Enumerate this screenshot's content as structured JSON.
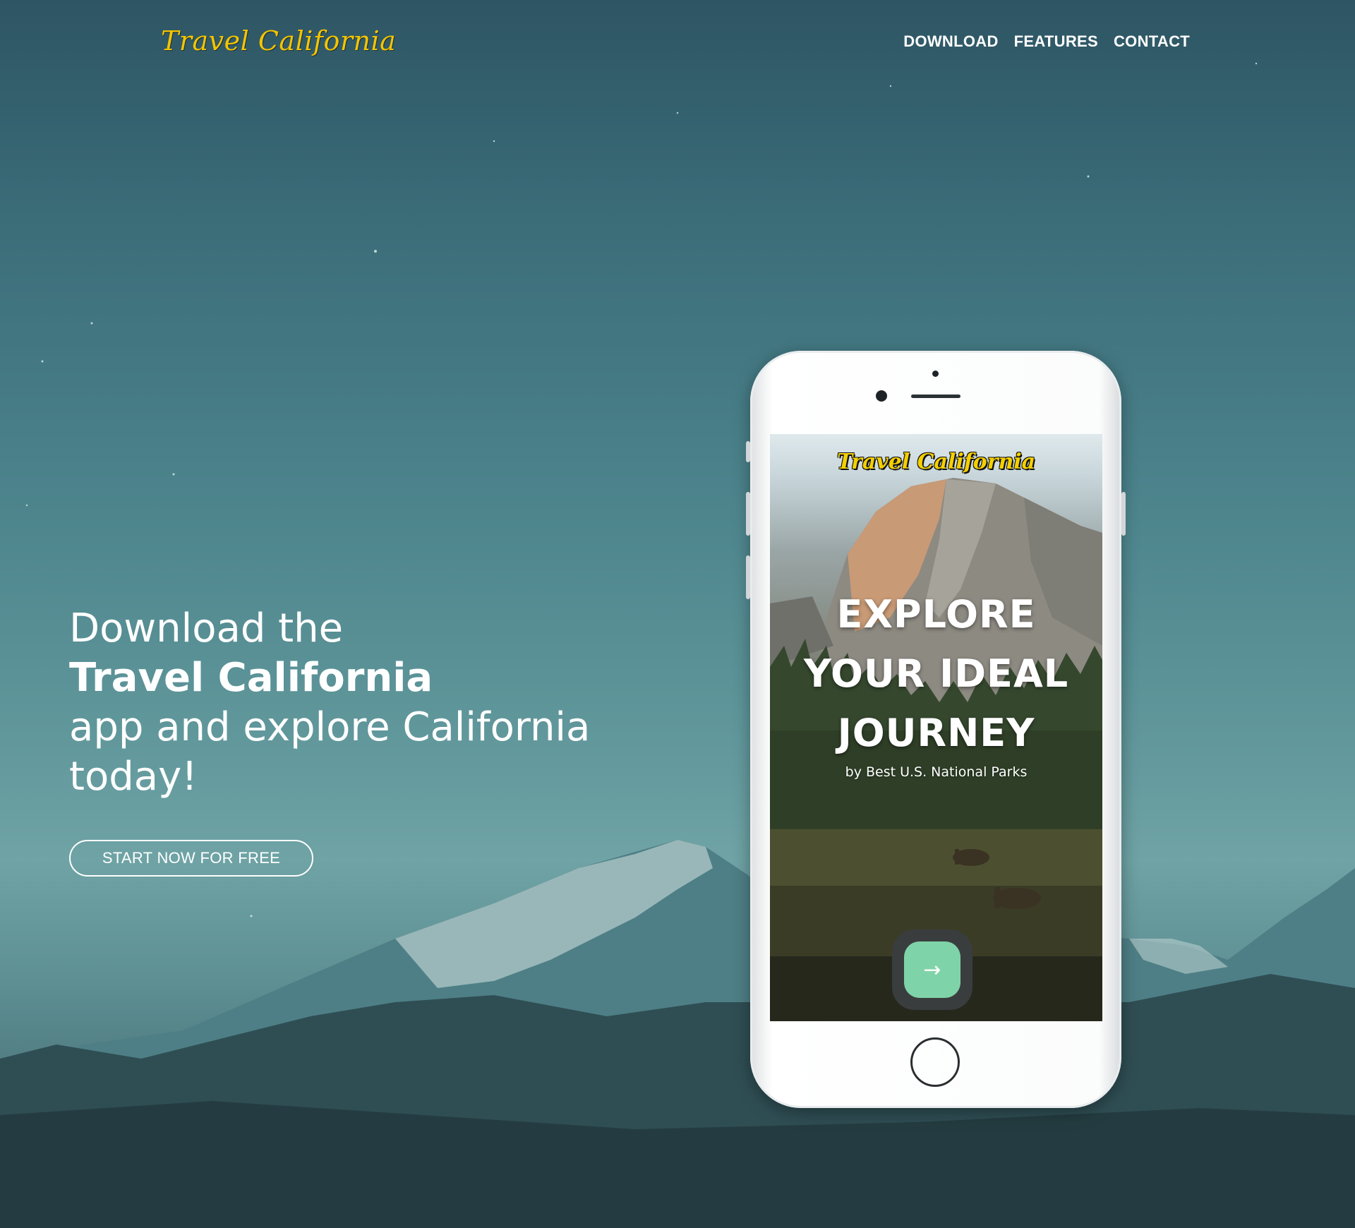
{
  "brand": {
    "logo_text": "Travel California"
  },
  "nav": {
    "items": [
      "DOWNLOAD",
      "FEATURES",
      "CONTACT"
    ]
  },
  "hero": {
    "line1": "Download the",
    "line2": "Travel California",
    "line3": "app and explore California",
    "line4": "today!",
    "cta_label": "START NOW FOR FREE"
  },
  "phone_screen": {
    "logo_text": "Travel California",
    "title_lines": [
      "EXPLORE",
      "YOUR IDEAL",
      "JOURNEY"
    ],
    "subtitle": "by Best U.S. National Parks",
    "next_icon": "→"
  },
  "colors": {
    "logo": "#f4c400",
    "app_button": "#7fd3a8"
  }
}
